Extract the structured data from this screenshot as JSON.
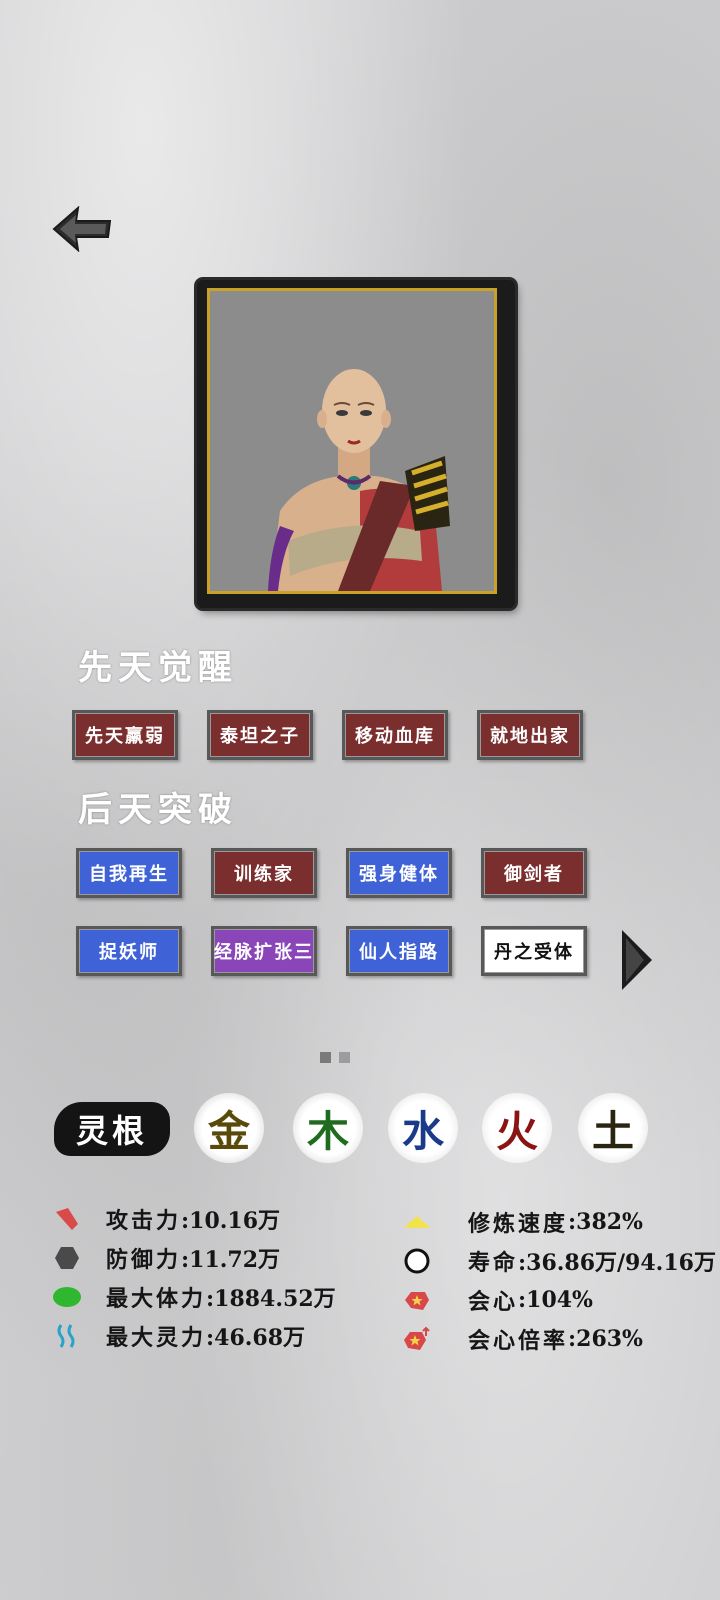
{
  "innate": {
    "title": "先天觉醒",
    "tags": [
      "先天羸弱",
      "泰坦之子",
      "移动血库",
      "就地出家"
    ]
  },
  "acquired": {
    "title": "后天突破",
    "tags": [
      "自我再生",
      "训练家",
      "强身健体",
      "御剑者",
      "捉妖师",
      "经脉扩张三",
      "仙人指路",
      "丹之受体"
    ]
  },
  "spirit_root": {
    "label": "灵根",
    "elements": [
      {
        "char": "金",
        "color": "#5a4a0a"
      },
      {
        "char": "木",
        "color": "#1f6b1f"
      },
      {
        "char": "水",
        "color": "#1a3a8a"
      },
      {
        "char": "火",
        "color": "#8a1414"
      },
      {
        "char": "土",
        "color": "#2a2410"
      }
    ]
  },
  "stats_left": [
    {
      "label": "攻击力",
      "value": ":10.16万",
      "icon": "attack-icon"
    },
    {
      "label": "防御力",
      "value": ":11.72万",
      "icon": "defense-icon"
    },
    {
      "label": "最大体力",
      "value": ":1884.52万",
      "icon": "health-icon"
    },
    {
      "label": "最大灵力",
      "value": ":46.68万",
      "icon": "spirit-icon"
    }
  ],
  "stats_right": [
    {
      "label": "修炼速度",
      "value": ":382%",
      "icon": "cultivation-speed-icon"
    },
    {
      "label": "寿命",
      "value": ":36.86万/94.16万",
      "icon": "lifespan-icon"
    },
    {
      "label": "会心",
      "value": ":104%",
      "icon": "critical-icon"
    },
    {
      "label": "会心倍率",
      "value": ":263%",
      "icon": "critical-multiplier-icon"
    }
  ],
  "colors": {
    "tag_red": "#7a2e2e",
    "tag_blue": "#3f63d6",
    "tag_purple": "#8a45b8",
    "tag_white": "#ffffff"
  },
  "pagination": {
    "pages": 2,
    "current": 1
  }
}
